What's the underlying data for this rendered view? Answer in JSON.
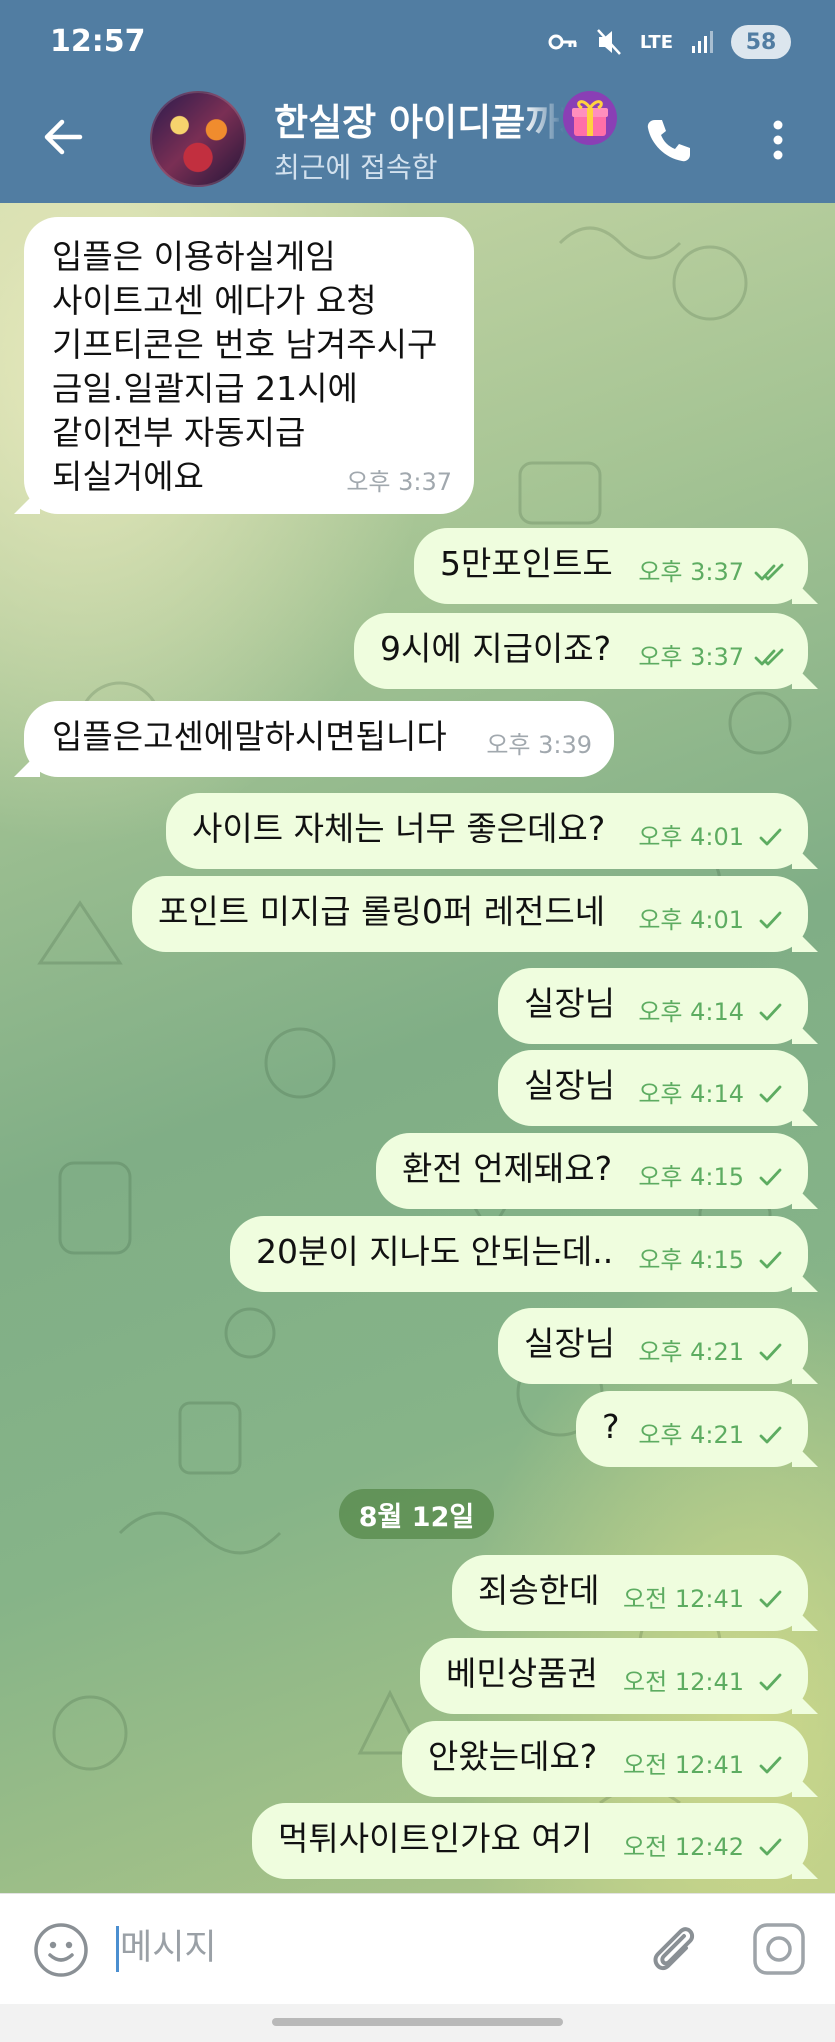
{
  "status_bar": {
    "time": "12:57",
    "network": "LTE",
    "battery": "58"
  },
  "header": {
    "title": "한실장 아이디끝까지",
    "subtitle": "최근에 접속함"
  },
  "messages": [
    {
      "dir": "in",
      "lines": [
        "입플은 이용하실게임",
        "사이트고센 에다가 요청",
        "기프티콘은 번호 남겨주시구",
        "금일.일괄지급 21시에",
        "같이전부 자동지급",
        "되실거에요"
      ],
      "time": "오후 3:37"
    },
    {
      "dir": "out",
      "lines": [
        "5만포인트도"
      ],
      "time": "오후 3:37",
      "status": "read"
    },
    {
      "dir": "out",
      "lines": [
        "9시에 지급이죠?"
      ],
      "time": "오후 3:37",
      "status": "read"
    },
    {
      "dir": "in",
      "lines": [
        "입플은고센에말하시면됩니다"
      ],
      "time": "오후 3:39"
    },
    {
      "dir": "out",
      "lines": [
        "사이트 자체는 너무 좋은데요?"
      ],
      "time": "오후 4:01",
      "status": "sent"
    },
    {
      "dir": "out",
      "lines": [
        "포인트 미지급 롤링0퍼 레전드네"
      ],
      "time": "오후 4:01",
      "status": "sent"
    },
    {
      "dir": "out",
      "lines": [
        "실장님"
      ],
      "time": "오후 4:14",
      "status": "sent"
    },
    {
      "dir": "out",
      "lines": [
        "실장님"
      ],
      "time": "오후 4:14",
      "status": "sent"
    },
    {
      "dir": "out",
      "lines": [
        "환전 언제돼요?"
      ],
      "time": "오후 4:15",
      "status": "sent"
    },
    {
      "dir": "out",
      "lines": [
        "20분이 지나도 안되는데.."
      ],
      "time": "오후 4:15",
      "status": "sent"
    },
    {
      "dir": "out",
      "lines": [
        "실장님"
      ],
      "time": "오후 4:21",
      "status": "sent"
    },
    {
      "dir": "out",
      "lines": [
        "?"
      ],
      "time": "오후 4:21",
      "status": "sent"
    },
    {
      "dir": "out",
      "lines": [
        "죄송한데"
      ],
      "time": "오전 12:41",
      "status": "sent"
    },
    {
      "dir": "out",
      "lines": [
        "베민상품권"
      ],
      "time": "오전 12:41",
      "status": "sent"
    },
    {
      "dir": "out",
      "lines": [
        "안왔는데요?"
      ],
      "time": "오전 12:41",
      "status": "sent"
    },
    {
      "dir": "out",
      "lines": [
        "먹튀사이트인가요 여기"
      ],
      "time": "오전 12:42",
      "status": "sent"
    }
  ],
  "date_divider": "8월 12일",
  "input": {
    "placeholder": "메시지",
    "value": ""
  },
  "colors": {
    "header": "#517da2",
    "incoming_bubble": "#ffffff",
    "outgoing_bubble": "#effdde",
    "read_check": "#5dac61",
    "date_pill": "#56884a"
  },
  "icons": [
    "back-arrow-icon",
    "gift-icon",
    "phone-icon",
    "more-vert-icon",
    "emoji-icon",
    "paperclip-icon",
    "camera-icon",
    "key-icon",
    "mute-icon",
    "signal-icon"
  ]
}
